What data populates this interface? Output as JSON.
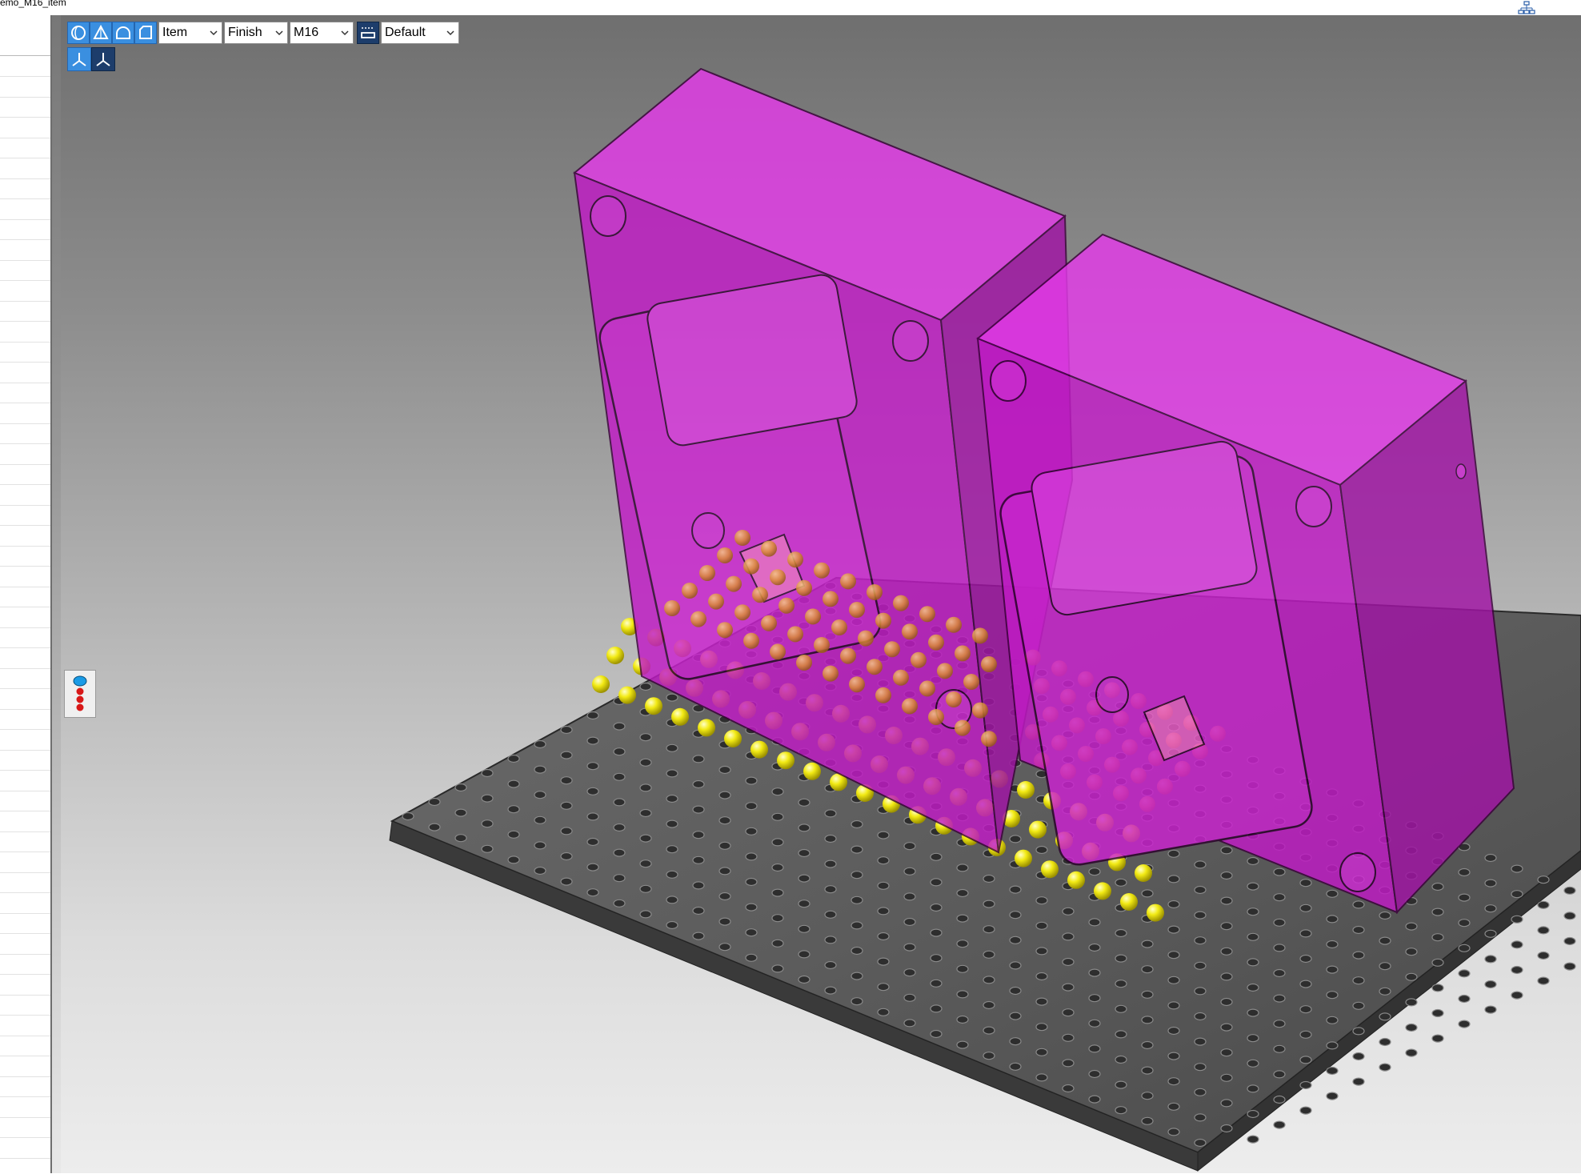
{
  "window": {
    "title": "emo_M16_item",
    "tree_icon": "hierarchy-icon"
  },
  "toolbar": {
    "view_buttons": [
      "sphere-view-icon",
      "cone-view-icon",
      "arc-view-icon",
      "box-view-icon"
    ],
    "item_combo": {
      "value": "Item"
    },
    "finish_combo": {
      "value": "Finish"
    },
    "thread_combo": {
      "value": "M16"
    },
    "style_button_icon": "display-style-icon",
    "default_combo": {
      "value": "Default"
    },
    "axis_buttons": [
      "axis-triad-icon",
      "axis-triad-alt-icon"
    ]
  },
  "side_widget": {
    "icon": "stacked-dots-icon"
  },
  "scene": {
    "colors": {
      "part": "#e11ee6",
      "plate": "#5a5a5a",
      "pin_yellow": "#f2ea14",
      "pin_orange": "#e39a3c",
      "background_top": "#6f6f6f",
      "background_bottom": "#ededed"
    }
  }
}
